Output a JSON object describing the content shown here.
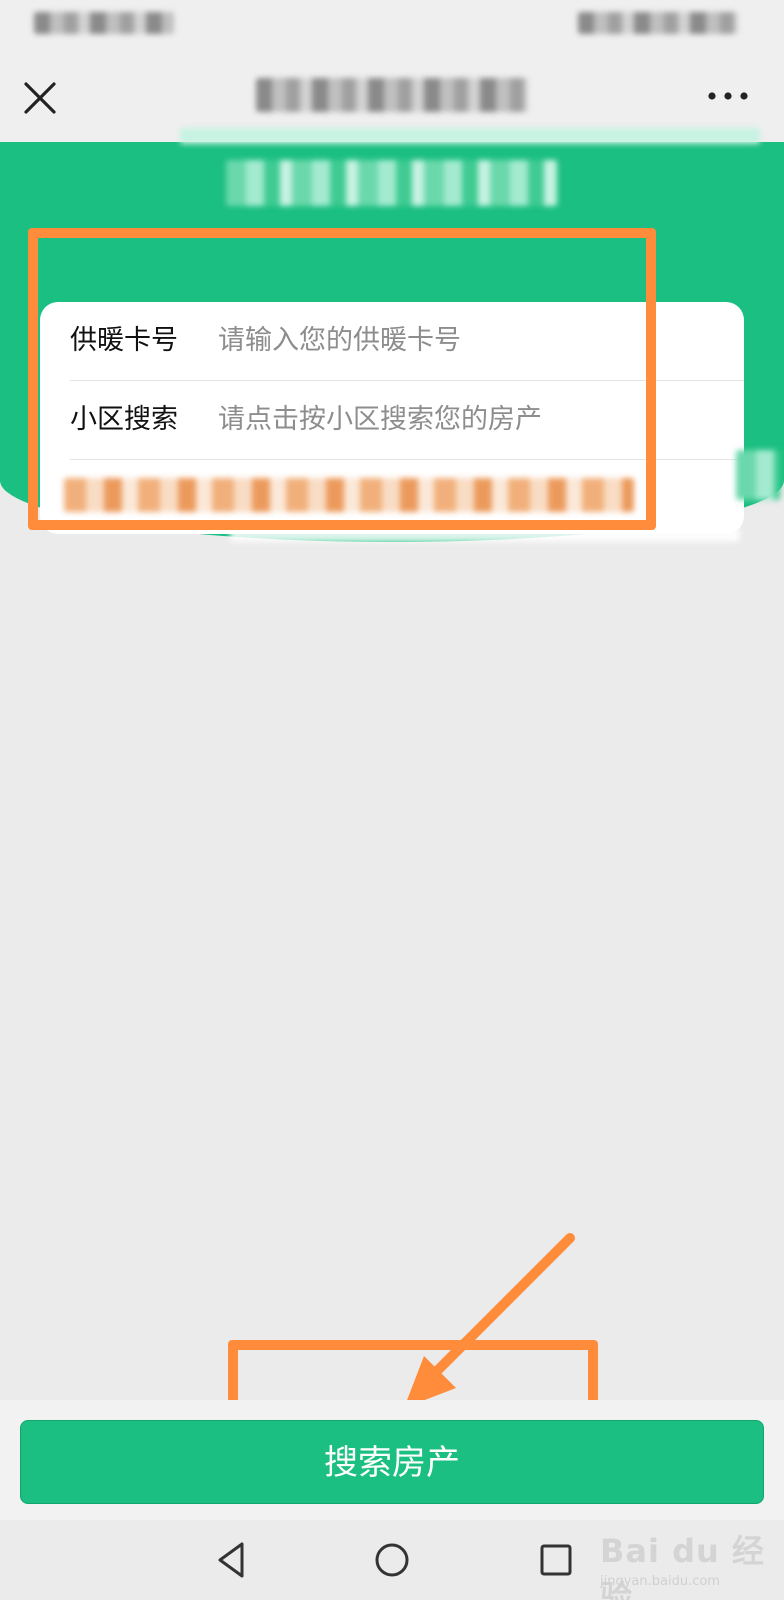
{
  "form": {
    "card_number_label": "供暖卡号",
    "card_number_placeholder": "请输入您的供暖卡号",
    "community_label": "小区搜索",
    "community_placeholder": "请点击按小区搜索您的房产"
  },
  "search_button_label": "搜索房产",
  "watermark": {
    "main": "Bai du 经验",
    "sub": "jingyan.baidu.com"
  },
  "colors": {
    "brand_green": "#1bbf81",
    "annotation_orange": "#ff8c3a"
  },
  "icons": {
    "close": "close-icon",
    "more": "more-icon",
    "back": "back-triangle-icon",
    "home": "home-circle-icon",
    "recents": "recents-square-icon"
  }
}
